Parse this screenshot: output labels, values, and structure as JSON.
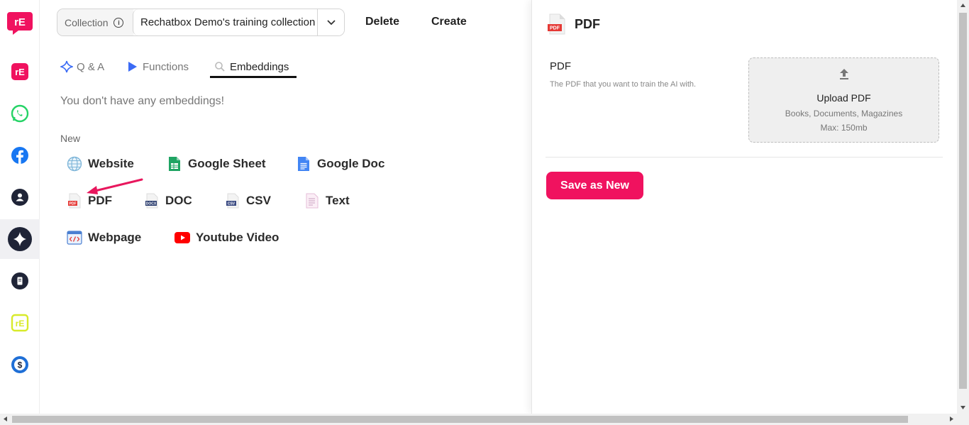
{
  "toolbar": {
    "collection_label": "Collection",
    "collection_value": "Rechatbox Demo's training collection",
    "delete_label": "Delete",
    "create_label": "Create"
  },
  "tabs": [
    {
      "label": "Q & A",
      "icon": "sparkle-icon"
    },
    {
      "label": "Functions",
      "icon": "play-icon"
    },
    {
      "label": "Embeddings",
      "icon": "search-icon",
      "active": true
    }
  ],
  "main": {
    "empty_message": "You don't have any embeddings!",
    "new_label": "New",
    "options": [
      {
        "label": "Website",
        "icon": "globe-icon"
      },
      {
        "label": "Google Sheet",
        "icon": "google-sheet-icon"
      },
      {
        "label": "Google Doc",
        "icon": "google-doc-icon"
      },
      {
        "label": "PDF",
        "icon": "pdf-file-icon"
      },
      {
        "label": "DOC",
        "icon": "doc-file-icon"
      },
      {
        "label": "CSV",
        "icon": "csv-file-icon"
      },
      {
        "label": "Text",
        "icon": "text-file-icon"
      },
      {
        "label": "Webpage",
        "icon": "webpage-code-icon"
      },
      {
        "label": "Youtube Video",
        "icon": "youtube-icon"
      }
    ]
  },
  "panel": {
    "title": "PDF",
    "field_title": "PDF",
    "field_description": "The PDF that you want to train the AI with.",
    "upload_title": "Upload PDF",
    "upload_subtitle": "Books, Documents, Magazines",
    "upload_max": "Max: 150mb",
    "save_label": "Save as New"
  },
  "colors": {
    "brand": "#f0125f",
    "dark_icon_bg": "#1f2437"
  }
}
